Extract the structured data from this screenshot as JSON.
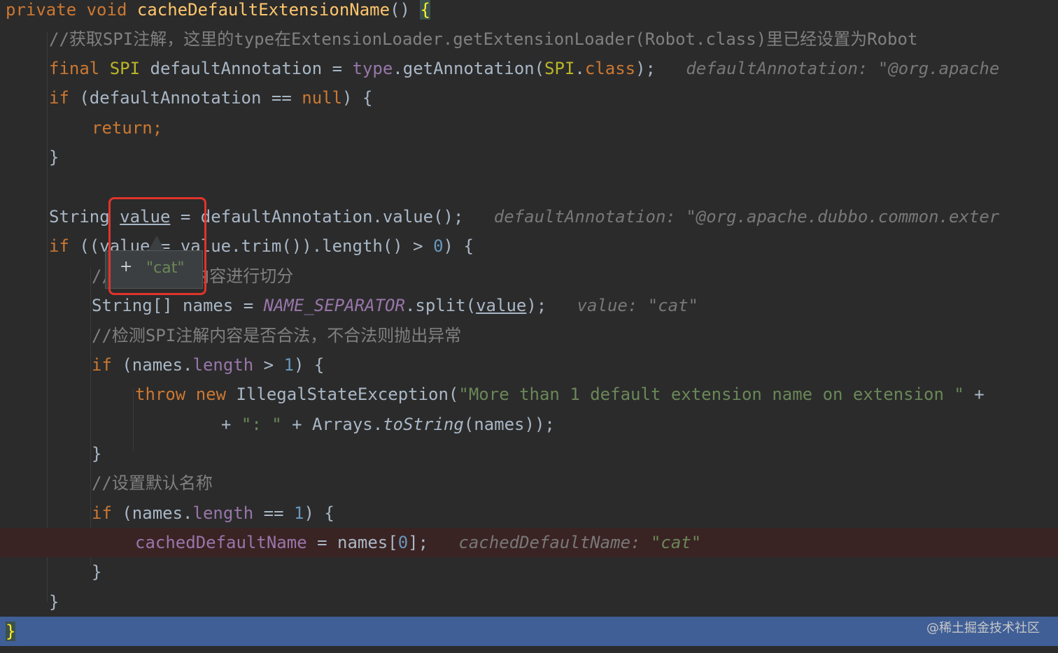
{
  "lines": [
    {
      "segs": [
        [
          "kw",
          "private void "
        ],
        [
          "fn",
          "cacheDefaultExtensionName"
        ],
        [
          "",
          "() "
        ],
        [
          "brace",
          "{"
        ]
      ]
    },
    {
      "segs": [
        [
          "cmt",
          "//获取SPI注解，这里的type在ExtensionLoader.getExtensionLoader(Robot.class)里已经设置为Robot"
        ]
      ]
    },
    {
      "segs": [
        [
          "kw",
          "final "
        ],
        [
          "ann",
          "SPI"
        ],
        [
          "",
          " defaultAnnotation = "
        ],
        [
          "field",
          "type"
        ],
        [
          "",
          ".getAnnotation("
        ],
        [
          "ann",
          "SPI"
        ],
        [
          "",
          "."
        ],
        [
          "kw",
          "class"
        ],
        [
          "",
          ");   "
        ],
        [
          "hint",
          "defaultAnnotation: \"@org.apache"
        ]
      ]
    },
    {
      "segs": [
        [
          "kw",
          "if "
        ],
        [
          "",
          "(defaultAnnotation == "
        ],
        [
          "kw",
          "null"
        ],
        [
          "",
          ") {"
        ]
      ]
    },
    {
      "segs": [
        [
          "kw",
          "return"
        ],
        [
          "kw",
          ";"
        ]
      ]
    },
    {
      "segs": [
        [
          "",
          "}"
        ]
      ]
    },
    {
      "segs": []
    },
    {
      "segs": [
        [
          "",
          "String "
        ],
        [
          "ul",
          "value"
        ],
        [
          "",
          " = defaultAnnotation.value();   "
        ],
        [
          "hint",
          "defaultAnnotation: \"@org.apache.dubbo.common.exter"
        ]
      ]
    },
    {
      "segs": [
        [
          "kw",
          "if "
        ],
        [
          "",
          "((value = value.trim()).length() > "
        ],
        [
          "num",
          "0"
        ],
        [
          "",
          ") {"
        ]
      ]
    },
    {
      "segs": [
        [
          "cmt",
          "//对SPI注解内容进行切分"
        ]
      ]
    },
    {
      "segs": [
        [
          "",
          "String[] names = "
        ],
        [
          "const",
          "NAME_SEPARATOR"
        ],
        [
          "",
          ".split("
        ],
        [
          "ul",
          "value"
        ],
        [
          "",
          ");   "
        ],
        [
          "hint",
          "value: \"cat\""
        ]
      ]
    },
    {
      "segs": [
        [
          "cmt",
          "//检测SPI注解内容是否合法，不合法则抛出异常"
        ]
      ]
    },
    {
      "segs": [
        [
          "kw",
          "if "
        ],
        [
          "",
          "(names."
        ],
        [
          "field",
          "length"
        ],
        [
          "",
          " > "
        ],
        [
          "num",
          "1"
        ],
        [
          "",
          ") {"
        ]
      ]
    },
    {
      "segs": [
        [
          "kw",
          "throw new "
        ],
        [
          "",
          "IllegalStateException("
        ],
        [
          "str",
          "\"More than 1 default extension name on extension \""
        ],
        [
          "",
          " +"
        ]
      ]
    },
    {
      "segs": [
        [
          "",
          "+ "
        ],
        [
          "str",
          "\": \""
        ],
        [
          "",
          " + Arrays."
        ],
        [
          "static",
          "toString"
        ],
        [
          "",
          "(names));"
        ]
      ]
    },
    {
      "segs": [
        [
          "",
          "}"
        ]
      ]
    },
    {
      "segs": [
        [
          "cmt",
          "//设置默认名称"
        ]
      ]
    },
    {
      "segs": [
        [
          "kw",
          "if "
        ],
        [
          "",
          "(names."
        ],
        [
          "field",
          "length"
        ],
        [
          "",
          " == "
        ],
        [
          "num",
          "1"
        ],
        [
          "",
          ") {"
        ]
      ]
    },
    {
      "segs": [
        [
          "field",
          "cachedDefaultName"
        ],
        [
          "",
          " = names["
        ],
        [
          "num",
          "0"
        ],
        [
          "",
          "];   "
        ],
        [
          "hint",
          "cachedDefaultName: "
        ],
        [
          "hintstr",
          "\"cat\""
        ]
      ]
    },
    {
      "segs": [
        [
          "",
          "}"
        ]
      ]
    },
    {
      "segs": [
        [
          "",
          "}"
        ]
      ]
    },
    {
      "segs": [
        [
          "brace",
          "}"
        ]
      ]
    }
  ],
  "popup": {
    "plus": "+",
    "value": "\"cat\""
  },
  "watermark": "@稀土掘金技术社区",
  "colors": {
    "background": "#2b2b2b",
    "keyword": "#cc7832",
    "string": "#6a8759",
    "highlight": "#e0342b",
    "current_line": "#3f5f96"
  }
}
